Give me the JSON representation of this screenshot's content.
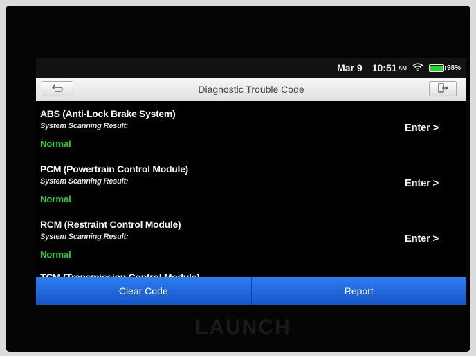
{
  "status_bar": {
    "date": "Mar 9",
    "time": "10:51",
    "ampm": "AM",
    "battery": "98%"
  },
  "title_bar": {
    "title": "Diagnostic Trouble Code"
  },
  "systems": [
    {
      "name": "ABS (Anti-Lock Brake System)",
      "result_label": "System Scanning Result:",
      "status": "Normal",
      "action": "Enter >"
    },
    {
      "name": "PCM (Powertrain Control Module)",
      "result_label": "System Scanning Result:",
      "status": "Normal",
      "action": "Enter >"
    },
    {
      "name": "RCM (Restraint Control Module)",
      "result_label": "System Scanning Result:",
      "status": "Normal",
      "action": "Enter >"
    },
    {
      "name": "TCM (Transmission Control Module)"
    }
  ],
  "buttons": {
    "clear_code": "Clear Code",
    "report": "Report"
  },
  "device": {
    "brand": "LAUNCH"
  },
  "colors": {
    "accent_blue": "#1f6ae0",
    "normal_green": "#2bd12b"
  }
}
